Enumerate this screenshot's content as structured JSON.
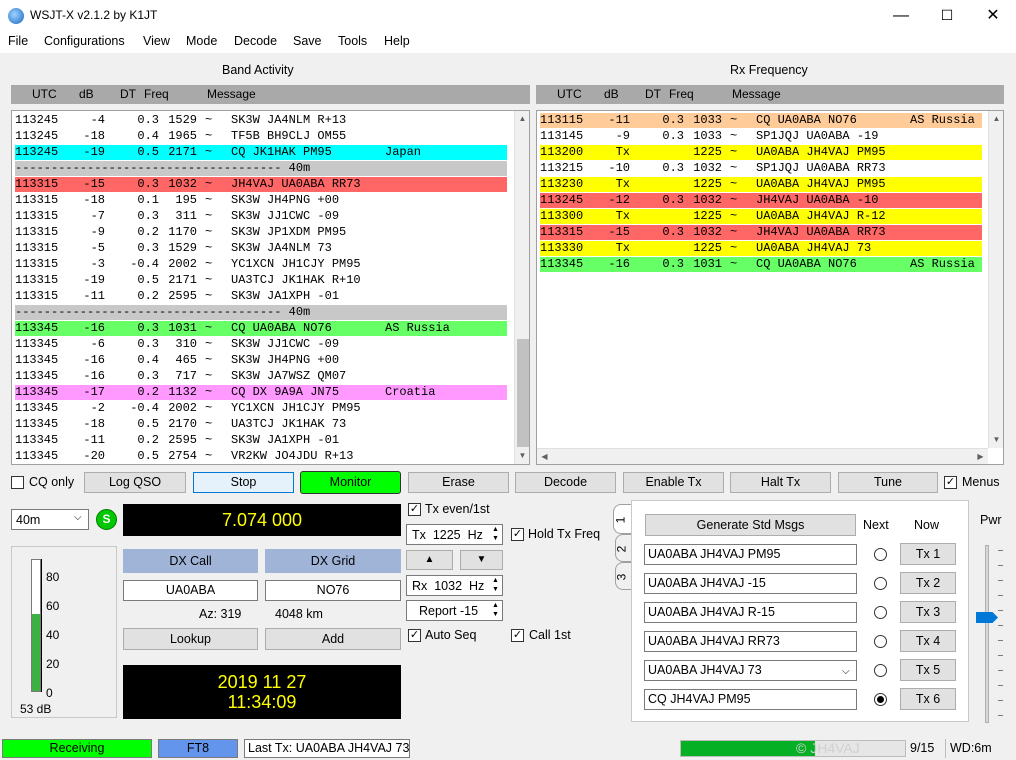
{
  "window": {
    "title": "WSJT-X   v2.1.2   by K1JT",
    "minimize": "—",
    "maximize": "☐",
    "close": "✕"
  },
  "menu": [
    "File",
    "Configurations",
    "View",
    "Mode",
    "Decode",
    "Save",
    "Tools",
    "Help"
  ],
  "band_activity": {
    "title": "Band Activity",
    "headers": {
      "utc": "UTC",
      "db": "dB",
      "dt": "DT",
      "freq": "Freq",
      "message": "Message"
    },
    "rows": [
      {
        "utc": "113245",
        "db": "-4",
        "dt": "0.3",
        "freq": "1529",
        "sym": "~",
        "msg": "SK3W JA4NLM R+13",
        "note": "",
        "color": "#ffffff"
      },
      {
        "utc": "113245",
        "db": "-18",
        "dt": "0.4",
        "freq": "1965",
        "sym": "~",
        "msg": "TF5B BH9CLJ OM55",
        "note": "",
        "color": "#ffffff"
      },
      {
        "utc": "113245",
        "db": "-19",
        "dt": "0.5",
        "freq": "2171",
        "sym": "~",
        "msg": "CQ JK1HAK PM95",
        "note": "Japan",
        "color": "#00ffff"
      },
      {
        "sep": "------------------------------------- 40m",
        "color": "#c8c8c8"
      },
      {
        "utc": "113315",
        "db": "-15",
        "dt": "0.3",
        "freq": "1032",
        "sym": "~",
        "msg": "JH4VAJ UA0ABA RR73",
        "note": "",
        "color": "#ff6666"
      },
      {
        "utc": "113315",
        "db": "-18",
        "dt": "0.1",
        "freq": "195",
        "sym": "~",
        "msg": "SK3W JH4PNG +00",
        "note": "",
        "color": "#ffffff"
      },
      {
        "utc": "113315",
        "db": "-7",
        "dt": "0.3",
        "freq": "311",
        "sym": "~",
        "msg": "SK3W JJ1CWC -09",
        "note": "",
        "color": "#ffffff"
      },
      {
        "utc": "113315",
        "db": "-9",
        "dt": "0.2",
        "freq": "1170",
        "sym": "~",
        "msg": "SK3W JP1XDM PM95",
        "note": "",
        "color": "#ffffff"
      },
      {
        "utc": "113315",
        "db": "-5",
        "dt": "0.3",
        "freq": "1529",
        "sym": "~",
        "msg": "SK3W JA4NLM 73",
        "note": "",
        "color": "#ffffff"
      },
      {
        "utc": "113315",
        "db": "-3",
        "dt": "-0.4",
        "freq": "2002",
        "sym": "~",
        "msg": "YC1XCN JH1CJY PM95",
        "note": "",
        "color": "#ffffff"
      },
      {
        "utc": "113315",
        "db": "-19",
        "dt": "0.5",
        "freq": "2171",
        "sym": "~",
        "msg": "UA3TCJ JK1HAK R+10",
        "note": "",
        "color": "#ffffff"
      },
      {
        "utc": "113315",
        "db": "-11",
        "dt": "0.2",
        "freq": "2595",
        "sym": "~",
        "msg": "SK3W JA1XPH -01",
        "note": "",
        "color": "#ffffff"
      },
      {
        "sep": "------------------------------------- 40m",
        "color": "#c8c8c8"
      },
      {
        "utc": "113345",
        "db": "-16",
        "dt": "0.3",
        "freq": "1031",
        "sym": "~",
        "msg": "CQ UA0ABA NO76",
        "note": "AS Russia",
        "color": "#66ff66"
      },
      {
        "utc": "113345",
        "db": "-6",
        "dt": "0.3",
        "freq": "310",
        "sym": "~",
        "msg": "SK3W JJ1CWC -09",
        "note": "",
        "color": "#ffffff"
      },
      {
        "utc": "113345",
        "db": "-16",
        "dt": "0.4",
        "freq": "465",
        "sym": "~",
        "msg": "SK3W JH4PNG +00",
        "note": "",
        "color": "#ffffff"
      },
      {
        "utc": "113345",
        "db": "-16",
        "dt": "0.3",
        "freq": "717",
        "sym": "~",
        "msg": "SK3W JA7WSZ QM07",
        "note": "",
        "color": "#ffffff"
      },
      {
        "utc": "113345",
        "db": "-17",
        "dt": "0.2",
        "freq": "1132",
        "sym": "~",
        "msg": "CQ DX 9A9A JN75",
        "note": "Croatia",
        "color": "#ff99ff"
      },
      {
        "utc": "113345",
        "db": "-2",
        "dt": "-0.4",
        "freq": "2002",
        "sym": "~",
        "msg": "YC1XCN JH1CJY PM95",
        "note": "",
        "color": "#ffffff"
      },
      {
        "utc": "113345",
        "db": "-18",
        "dt": "0.5",
        "freq": "2170",
        "sym": "~",
        "msg": "UA3TCJ JK1HAK 73",
        "note": "",
        "color": "#ffffff"
      },
      {
        "utc": "113345",
        "db": "-11",
        "dt": "0.2",
        "freq": "2595",
        "sym": "~",
        "msg": "SK3W JA1XPH -01",
        "note": "",
        "color": "#ffffff"
      },
      {
        "utc": "113345",
        "db": "-20",
        "dt": "0.5",
        "freq": "2754",
        "sym": "~",
        "msg": "VR2KW JO4JDU R+13",
        "note": "",
        "color": "#ffffff"
      }
    ]
  },
  "rx_frequency": {
    "title": "Rx Frequency",
    "headers": {
      "utc": "UTC",
      "db": "dB",
      "dt": "DT",
      "freq": "Freq",
      "message": "Message"
    },
    "rows": [
      {
        "utc": "113115",
        "db": "-11",
        "dt": "0.3",
        "freq": "1033",
        "sym": "~",
        "msg": "CQ UA0ABA NO76",
        "note": "AS Russia",
        "color": "#ffcc99"
      },
      {
        "utc": "113145",
        "db": "-9",
        "dt": "0.3",
        "freq": "1033",
        "sym": "~",
        "msg": "SP1JQJ UA0ABA -19",
        "note": "",
        "color": "#ffffff"
      },
      {
        "utc": "113200",
        "db": "Tx",
        "dt": "",
        "freq": "1225",
        "sym": "~",
        "msg": "UA0ABA JH4VAJ PM95",
        "note": "",
        "color": "#ffff00"
      },
      {
        "utc": "113215",
        "db": "-10",
        "dt": "0.3",
        "freq": "1032",
        "sym": "~",
        "msg": "SP1JQJ UA0ABA RR73",
        "note": "",
        "color": "#ffffff"
      },
      {
        "utc": "113230",
        "db": "Tx",
        "dt": "",
        "freq": "1225",
        "sym": "~",
        "msg": "UA0ABA JH4VAJ PM95",
        "note": "",
        "color": "#ffff00"
      },
      {
        "utc": "113245",
        "db": "-12",
        "dt": "0.3",
        "freq": "1032",
        "sym": "~",
        "msg": "JH4VAJ UA0ABA -10",
        "note": "",
        "color": "#ff6666"
      },
      {
        "utc": "113300",
        "db": "Tx",
        "dt": "",
        "freq": "1225",
        "sym": "~",
        "msg": "UA0ABA JH4VAJ R-12",
        "note": "",
        "color": "#ffff00"
      },
      {
        "utc": "113315",
        "db": "-15",
        "dt": "0.3",
        "freq": "1032",
        "sym": "~",
        "msg": "JH4VAJ UA0ABA RR73",
        "note": "",
        "color": "#ff6666"
      },
      {
        "utc": "113330",
        "db": "Tx",
        "dt": "",
        "freq": "1225",
        "sym": "~",
        "msg": "UA0ABA JH4VAJ 73",
        "note": "",
        "color": "#ffff00"
      },
      {
        "utc": "113345",
        "db": "-16",
        "dt": "0.3",
        "freq": "1031",
        "sym": "~",
        "msg": "CQ UA0ABA NO76",
        "note": "AS Russia",
        "color": "#66ff66"
      }
    ]
  },
  "controls": {
    "cq_only": "CQ only",
    "log_qso": "Log QSO",
    "stop": "Stop",
    "monitor": "Monitor",
    "erase": "Erase",
    "decode": "Decode",
    "enable_tx": "Enable Tx",
    "halt_tx": "Halt Tx",
    "tune": "Tune",
    "menus": "Menus"
  },
  "band": {
    "value": "40m",
    "s_badge": "S"
  },
  "frequency_display": "7.074 000",
  "dx": {
    "call_label": "DX Call",
    "grid_label": "DX Grid",
    "call": "UA0ABA",
    "grid": "NO76",
    "az": "Az: 319",
    "dist": "4048 km",
    "lookup": "Lookup",
    "add": "Add"
  },
  "clock": {
    "date": "2019 11 27",
    "time": "11:34:09"
  },
  "meter": {
    "ticks": [
      "80",
      "60",
      "40",
      "20",
      "0"
    ],
    "level_db": "53 dB",
    "level_value": 53
  },
  "tx_controls": {
    "tx_even": "Tx even/1st",
    "tx_freq": "Tx  1225  Hz",
    "hold_tx_freq": "Hold Tx Freq",
    "up": "▲",
    "down": "▼",
    "rx_freq": "Rx  1032  Hz",
    "report": "Report -15",
    "auto_seq": "Auto Seq",
    "call_1st": "Call 1st"
  },
  "tabs": [
    "1",
    "2",
    "3"
  ],
  "messages": {
    "generate": "Generate Std Msgs",
    "next": "Next",
    "now": "Now",
    "items": [
      {
        "text": "UA0ABA JH4VAJ PM95",
        "btn": "Tx 1"
      },
      {
        "text": "UA0ABA JH4VAJ -15",
        "btn": "Tx 2"
      },
      {
        "text": "UA0ABA JH4VAJ R-15",
        "btn": "Tx 3"
      },
      {
        "text": "UA0ABA JH4VAJ RR73",
        "btn": "Tx 4"
      },
      {
        "text": "UA0ABA JH4VAJ 73",
        "btn": "Tx 5"
      },
      {
        "text": "CQ JH4VAJ PM95",
        "btn": "Tx 6"
      }
    ]
  },
  "pwr": "Pwr",
  "status": {
    "receiving": "Receiving",
    "mode": "FT8",
    "last_tx": "Last Tx: UA0ABA JH4VAJ 73",
    "progress_text": "9/15",
    "wd": "WD:6m",
    "progress_fraction": 0.6,
    "watermark": "© JH4VAJ"
  },
  "colors": {
    "monitor_green": "#00ff00",
    "receiving_green": "#00ff00",
    "ft8_blue": "#6495ed",
    "lcd_bg": "#000000",
    "lcd_text": "#ffff00"
  }
}
